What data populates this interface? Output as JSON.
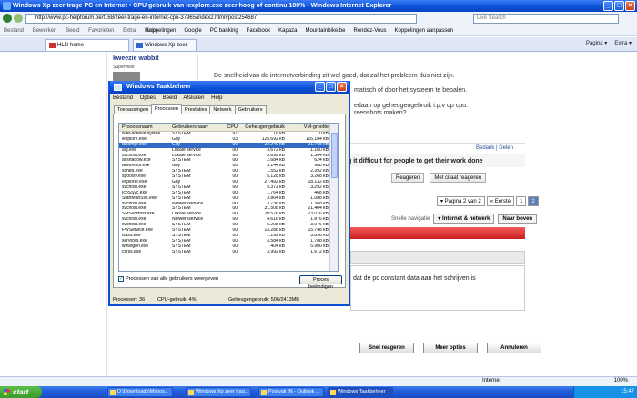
{
  "ie": {
    "title": "Windows Xp zeer trage PC en Internet • CPU gebruik van iexplore.exe zeer hoog of continu 100% - Windows Internet Explorer",
    "url": "http://www.pc-helpforum.be/f168/zeer-trage-en-internet-cpu-37965/index2.html#post254687",
    "search_placeholder": "Live Search",
    "menu": [
      "Bestand",
      "Bewerken",
      "Beeld",
      "Favorieten",
      "Extra",
      "Help"
    ],
    "favorites_label": "Koppelingen",
    "favorites": [
      "Google",
      "PC banking",
      "Facebook",
      "Kapaza",
      "Mountainbike.be",
      "Rendez-Vous",
      "Koppelingen aanpassen"
    ],
    "tabs": [
      "HLN-home",
      "Windows Xp zeer trage P..."
    ],
    "tools": [
      "Pagina ▾",
      "Extra ▾"
    ],
    "status_zone": "Internet",
    "zoom": "100%"
  },
  "forum": {
    "username": "kweezie wabbit",
    "role": "Supervisor",
    "post_line1": "De snelheid van de internetverbinding zit wel goed, dat zal het probleem dus niet zijn.",
    "post_line2": "matisch of door het systeem te bepalen.",
    "post_line3": "edaan op geheugengebruik i.p.v op cpu.",
    "post_line4": "reenshots maken?",
    "post_links": "Bedank | Delen",
    "signature": "g it difficult for people to get their work done",
    "reply_btn": "Reageren",
    "quote_btn": "Met citaat reageren",
    "pager_text": "▾ Pagina 2 van 2",
    "pager_first": "« Eerste",
    "pager_p1": "1",
    "pager_p2": "2",
    "snel_label": "Snelle navigatie",
    "snel_forum": "▾ Internet & netwerk",
    "snel_top": "Naar boven",
    "editor_text": "dat de pc constant data aan het schrijven is",
    "btn_quick": "Snel reageren",
    "btn_more": "Meer opties",
    "btn_cancel": "Annuleren"
  },
  "tm": {
    "title": "Windows Taakbeheer",
    "menu": [
      "Bestand",
      "Opties",
      "Beeld",
      "Afsluiten",
      "Help"
    ],
    "tabs": [
      "Toepassingen",
      "Processen",
      "Prestaties",
      "Netwerk",
      "Gebruikers"
    ],
    "headers": [
      "Processnaam",
      "Gebruikersnaam",
      "CPU",
      "Geheugengebruik",
      "VM-grootte"
    ],
    "rows": [
      [
        "Niet-actieve systee...",
        "SYSTEM",
        "97",
        "16 kB",
        "0 kB"
      ],
      [
        "iexplore.exe",
        "Guy",
        "03",
        "125.692 kB",
        "116.184 kB"
      ],
      [
        "taskmgr.exe",
        "Guy",
        "00",
        "22.240 kB",
        "21.768 kB"
      ],
      [
        "alg.exe",
        "Lokale service",
        "00",
        "3.672 kB",
        "1.160 kB"
      ],
      [
        "svchost.exe",
        "Lokale service",
        "00",
        "3.892 kB",
        "1.364 kB"
      ],
      [
        "avshadow.exe",
        "SYSTEM",
        "00",
        "2.684 kB",
        "624 kB"
      ],
      [
        "IEMonitor.exe",
        "Guy",
        "00",
        "3.144 kB",
        "988 kB"
      ],
      [
        "sched.exe",
        "SYSTEM",
        "00",
        "1.552 kB",
        "2.392 kB"
      ],
      [
        "spoolsv.exe",
        "SYSTEM",
        "00",
        "5.128 kB",
        "3.268 kB"
      ],
      [
        "explorer.exe",
        "Guy",
        "00",
        "27.492 kB",
        "18.132 kB"
      ],
      [
        "svchost.exe",
        "SYSTEM",
        "00",
        "5.372 kB",
        "3.292 kB"
      ],
      [
        "IcoSSvc.exe",
        "SYSTEM",
        "00",
        "1.764 kB",
        "468 kB"
      ],
      [
        "StartManSvc.exe",
        "SYSTEM",
        "00",
        "3.864 kB",
        "1.088 kB"
      ],
      [
        "svchost.exe",
        "Netwerkservice",
        "00",
        "3.736 kB",
        "1.368 kB"
      ],
      [
        "svchost.exe",
        "SYSTEM",
        "00",
        "31.508 kB",
        "21.404 kB"
      ],
      [
        "SMSvcHost.exe",
        "Lokale service",
        "00",
        "20.576 kB",
        "23.076 kB"
      ],
      [
        "svchost.exe",
        "Netwerkservice",
        "00",
        "4.616 kB",
        "1.876 kB"
      ],
      [
        "svchost.exe",
        "SYSTEM",
        "00",
        "5.208 kB",
        "3.076 kB"
      ],
      [
        "FWService.exe",
        "SYSTEM",
        "00",
        "13.288 kB",
        "15.748 kB"
      ],
      [
        "lsass.exe",
        "SYSTEM",
        "00",
        "1.192 kB",
        "3.896 kB"
      ],
      [
        "services.exe",
        "SYSTEM",
        "00",
        "3.584 kB",
        "1.788 kB"
      ],
      [
        "winlogon.exe",
        "SYSTEM",
        "00",
        "404 kB",
        "5.900 kB"
      ],
      [
        "csrss.exe",
        "SYSTEM",
        "00",
        "3.992 kB",
        "1.672 kB"
      ]
    ],
    "show_all": "Processen van alle gebruikers weergeven",
    "end_btn": "Proces beëindigen",
    "status_proc": "Processen: 36",
    "status_cpu": "CPU-gebruik: 4%",
    "status_mem": "Geheugengebruik: 506/2413MB"
  },
  "taskbar": {
    "start": "start",
    "items": [
      "D:\\Downloads\\Micros...",
      "Windows Xp zeer trag...",
      "Postvak IN - Outlook ...",
      "Windows Taakbeheer"
    ],
    "clock": "15:47"
  }
}
